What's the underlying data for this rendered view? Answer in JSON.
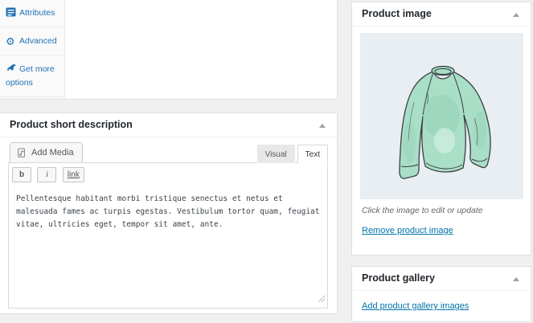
{
  "product_data_box": {
    "tabs": [
      {
        "label": "Attributes",
        "icon": "attributes-icon"
      },
      {
        "label": "Advanced",
        "icon": "gear-icon"
      },
      {
        "label": "Get more options",
        "icon": "megaphone-icon"
      }
    ]
  },
  "short_description": {
    "title": "Product short description",
    "add_media": "Add Media",
    "tab_visual": "Visual",
    "tab_text": "Text",
    "active_tab": "Text",
    "quicktags": {
      "bold": "b",
      "italic": "i",
      "link": "link"
    },
    "content": "Pellentesque habitant morbi tristique senectus et netus et malesuada fames ac turpis egestas. Vestibulum tortor quam, feugiat vitae, ultricies eget, tempor sit amet, ante."
  },
  "product_image": {
    "title": "Product image",
    "image_description": "mint-green long-sleeve shirt illustration",
    "caption": "Click the image to edit or update",
    "remove_link": "Remove product image"
  },
  "product_gallery": {
    "title": "Product gallery",
    "add_link": "Add product gallery images"
  },
  "colors": {
    "link_blue": "#0073aa",
    "sidebar_tab_blue": "#2271b1",
    "page_background": "#f0f0f1",
    "shirt_fill": "#a9dec7",
    "thumb_background": "#e9eef2"
  }
}
